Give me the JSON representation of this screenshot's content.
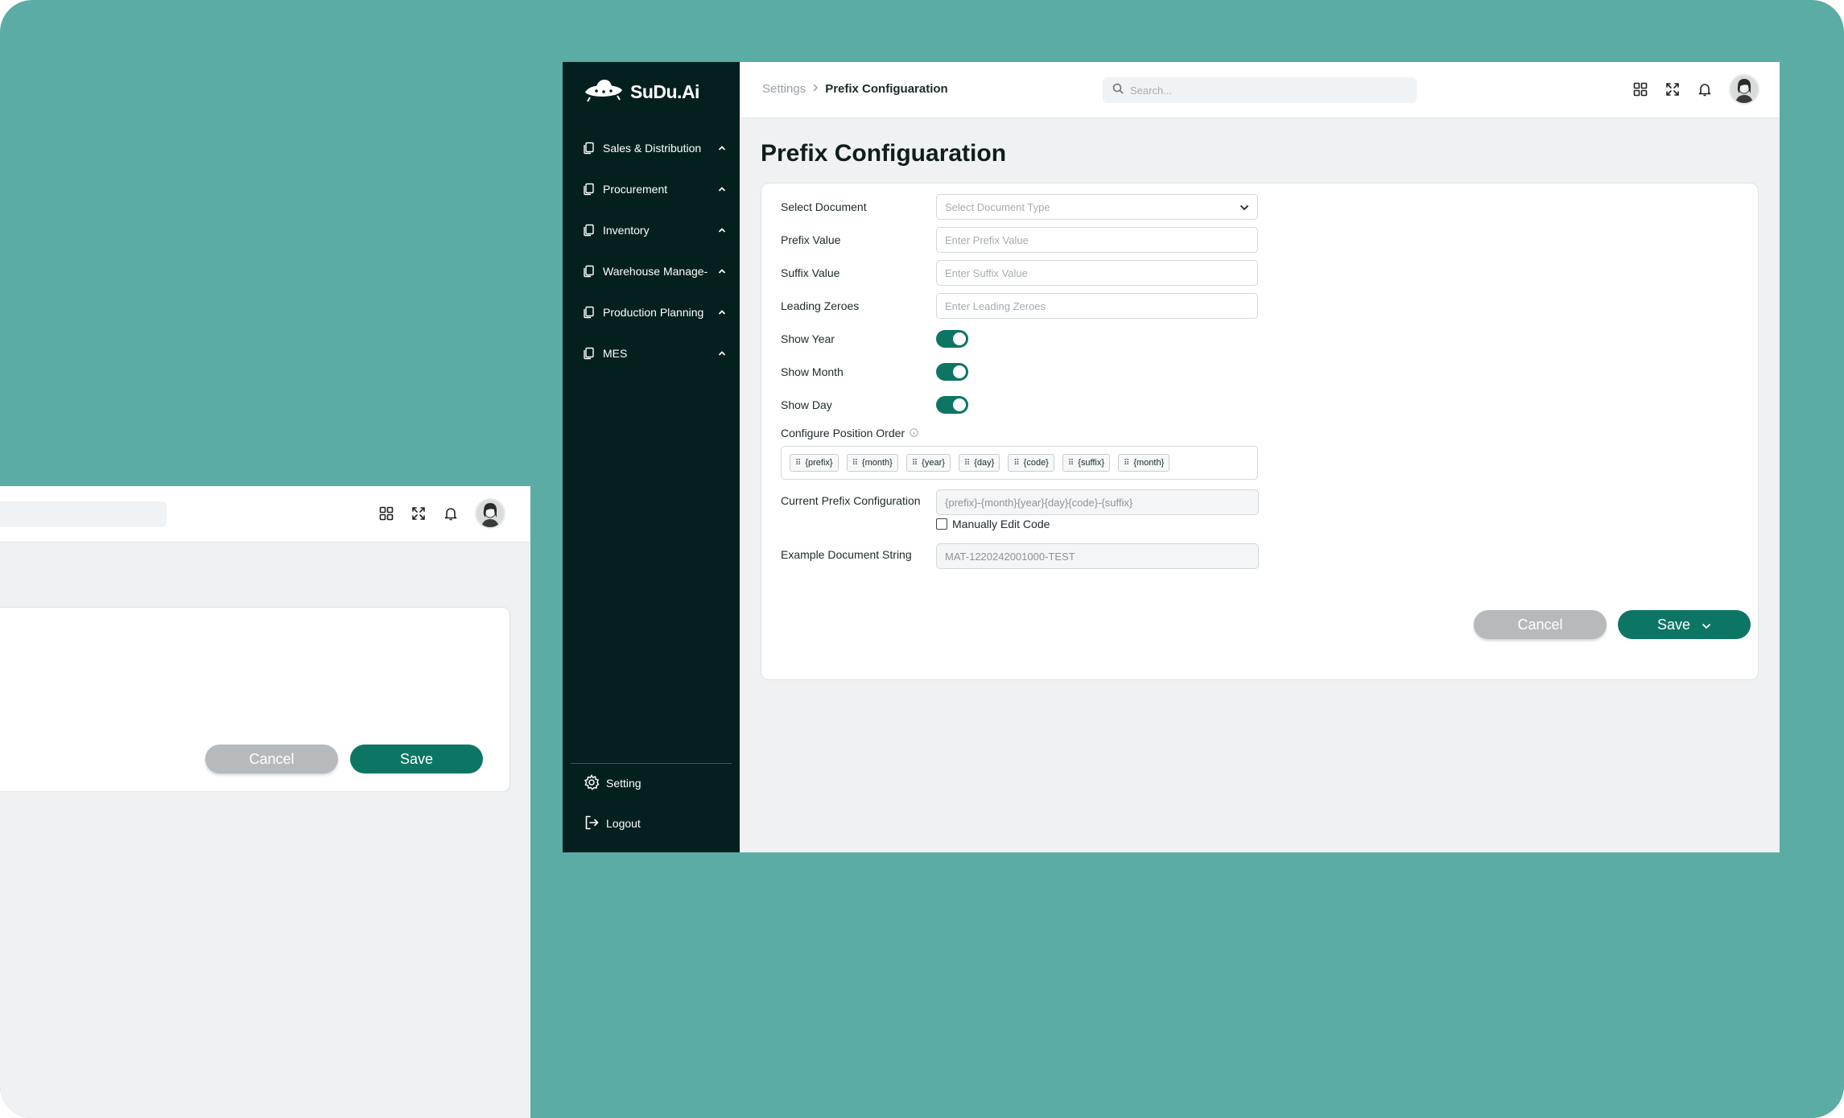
{
  "colors": {
    "backdrop": "#5aaca4",
    "sidebar": "#03201e",
    "accent": "#0d7564",
    "cancel": "#b7babd"
  },
  "brand": {
    "name": "SuDu.Ai",
    "logo_icon": "ufo-icon"
  },
  "sidebar": {
    "items": [
      {
        "label": "Sales & Distribution",
        "icon": "copy-icon"
      },
      {
        "label": "Procurement",
        "icon": "copy-icon"
      },
      {
        "label": "Inventory",
        "icon": "copy-icon"
      },
      {
        "label": "Warehouse Manage-",
        "icon": "copy-icon"
      },
      {
        "label": "Production Planning",
        "icon": "copy-icon"
      },
      {
        "label": "MES",
        "icon": "copy-icon"
      }
    ],
    "setting_label": "Setting",
    "logout_label": "Logout"
  },
  "header": {
    "breadcrumb_root": "Settings",
    "breadcrumb_current": "Prefix Configuaration",
    "search_placeholder": "Search...",
    "icons": [
      "grid-icon",
      "expand-icon",
      "bell-icon",
      "avatar"
    ]
  },
  "page": {
    "title": "Prefix Configuaration"
  },
  "form": {
    "select_document": {
      "label": "Select Document",
      "placeholder": "Select Document Type"
    },
    "prefix_value": {
      "label": "Prefix Value",
      "placeholder": "Enter Prefix Value"
    },
    "suffix_value": {
      "label": "Suffix Value",
      "placeholder": "Enter Suffix Value"
    },
    "leading_zeroes": {
      "label": "Leading Zeroes",
      "placeholder": "Enter Leading Zeroes"
    },
    "show_year": {
      "label": "Show Year",
      "on": true
    },
    "show_month": {
      "label": "Show Month",
      "on": true
    },
    "show_day": {
      "label": "Show Day",
      "on": true
    },
    "position_order": {
      "label": "Configure Position Order",
      "tokens": [
        "{prefix}",
        "{month}",
        "{year}",
        "{day}",
        "{code}",
        "{suffix}",
        "{month}"
      ]
    },
    "current_config": {
      "label": "Current Prefix Configuration",
      "value": "{prefix}-{month}{year}{day}{code}-{suffix}"
    },
    "manual_edit": {
      "label": "Manually Edit Code",
      "checked": false
    },
    "example_string": {
      "label": "Example Document String",
      "value": "MAT-1220242001000-TEST"
    },
    "cancel_label": "Cancel",
    "save_label": "Save"
  },
  "back_window": {
    "cancel_label": "Cancel",
    "save_label": "Save"
  }
}
